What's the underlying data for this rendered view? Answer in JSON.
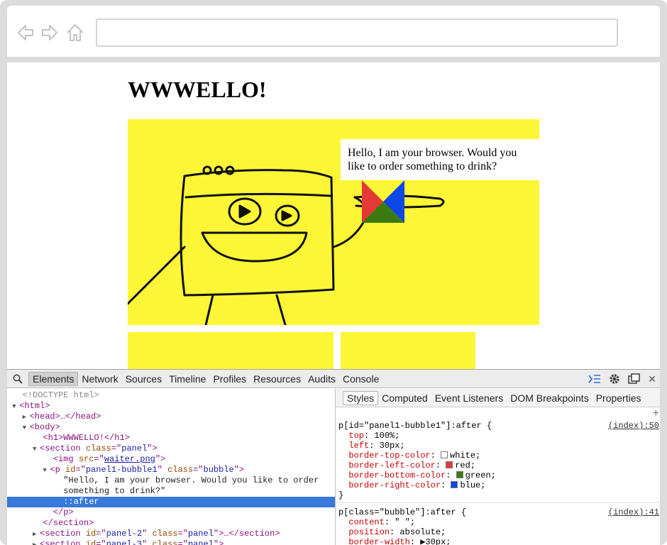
{
  "page": {
    "heading": "WWWELLO!",
    "bubble_text": "Hello, I am your browser. Would you like to order something to drink?"
  },
  "colors": {
    "panel_yellow": "#fdf636",
    "bubble_left": "#e53935",
    "bubble_right": "#0d47e8",
    "bubble_bottom": "#3a7a10",
    "selection": "#3879d9"
  },
  "devtools": {
    "tabs": [
      "Elements",
      "Network",
      "Sources",
      "Timeline",
      "Profiles",
      "Resources",
      "Audits",
      "Console"
    ],
    "active_tab": "Elements",
    "elements": {
      "doctype": "<!DOCTYPE html>",
      "html_open": "<html>",
      "head_collapsed": "<head>…</head>",
      "body_open": "<body>",
      "h1": "<h1>WWWELLO!</h1>",
      "section_open_tag": "section",
      "section_open_attr": "class",
      "section_open_val": "panel",
      "img_tag": "img",
      "img_attr": "src",
      "img_src": "waiter.png",
      "p_tag": "p",
      "p_id_attr": "id",
      "p_id_val": "panel1-bubble1",
      "p_class_attr": "class",
      "p_class_val": "bubble",
      "text_line1": "\"Hello, I am your browser. Would you like to order",
      "text_line2": "something to drink?\"",
      "pseudo": "::after",
      "p_close": "</p>",
      "section_close": "</section>",
      "section2_id": "panel-2",
      "section2_class": "panel",
      "section3_id": "panel-3",
      "section3_class": "panel"
    },
    "styles_tabs": [
      "Styles",
      "Computed",
      "Event Listeners",
      "DOM Breakpoints",
      "Properties"
    ],
    "active_styles_tab": "Styles",
    "rules": [
      {
        "selector": "p[id=\"panel1-bubble1\"]:after {",
        "source": "(index):50",
        "props": [
          {
            "name": "top",
            "value": "100%;"
          },
          {
            "name": "left",
            "value": "30px;"
          },
          {
            "name": "border-top-color",
            "value": "white;",
            "swatch": "#ffffff"
          },
          {
            "name": "border-left-color",
            "value": "red;",
            "swatch": "#e53935"
          },
          {
            "name": "border-bottom-color",
            "value": "green;",
            "swatch": "#3a7a10"
          },
          {
            "name": "border-right-color",
            "value": "blue;",
            "swatch": "#0d47e8"
          }
        ],
        "close": "}"
      },
      {
        "selector": "p[class=\"bubble\"]:after {",
        "source": "(index):41",
        "props": [
          {
            "name": "content",
            "value": "\" \";"
          },
          {
            "name": "position",
            "value": "absolute;"
          },
          {
            "name": "border-width",
            "value": "▶30px;"
          }
        ]
      }
    ]
  }
}
